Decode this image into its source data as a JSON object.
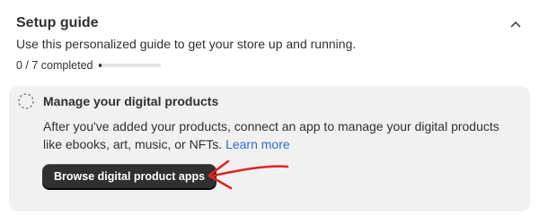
{
  "setup_guide": {
    "title": "Setup guide",
    "subtitle": "Use this personalized guide to get your store up and running.",
    "progress": {
      "text": "0 / 7 completed",
      "completed": 0,
      "total": 7,
      "fill_fraction": 0.04
    }
  },
  "task": {
    "title": "Manage your digital products",
    "description": "After you've added your products, connect an app to manage your digital products like ebooks, art, music, or NFTs.",
    "link_label": "Learn more",
    "button_label": "Browse digital product apps"
  },
  "icons": {
    "collapse": "chevron-up-icon",
    "task_status": "dashed-circle-icon"
  },
  "colors": {
    "primary_button": "#303030",
    "link": "#2c6ecb",
    "annotation_arrow": "#e02424",
    "panel_background": "#f1f1f1"
  }
}
